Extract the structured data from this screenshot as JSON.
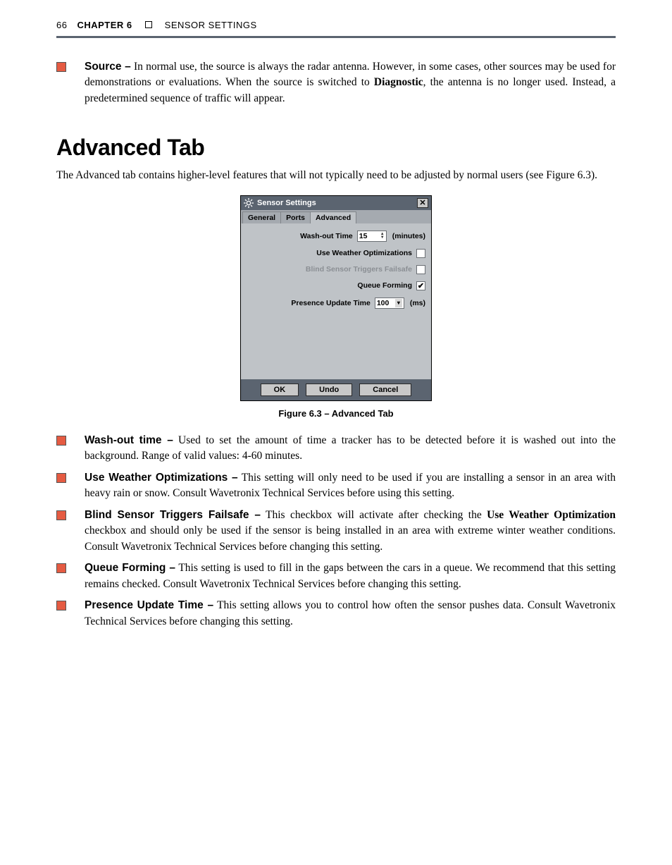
{
  "header": {
    "pageno": "66",
    "chapter_label": "CHAPTER 6",
    "section_name": "SENSOR SETTINGS"
  },
  "bullet_top": {
    "term": "Source –",
    "text": " In normal use, the source is always the radar antenna. However, in some cases, other sources may be used for demonstrations or evaluations. When the source is switched to ",
    "bold_inline": "Diagnostic",
    "text2": ", the antenna is no longer used. Instead, a predetermined sequence of traffic will appear."
  },
  "section_heading": "Advanced Tab",
  "intro_para": "The Advanced tab contains higher-level features that will not typically need to be adjusted by normal users (see Figure 6.3).",
  "dialog": {
    "title": "Sensor Settings",
    "tabs": [
      "General",
      "Ports",
      "Advanced"
    ],
    "active_tab_index": 2,
    "washout_label": "Wash-out Time",
    "washout_value": "15",
    "washout_unit": "(minutes)",
    "weather_label": "Use Weather Optimizations",
    "blind_label": "Blind Sensor Triggers Failsafe",
    "queue_label": "Queue Forming",
    "queue_checked": "✔",
    "presence_label": "Presence Update Time",
    "presence_value": "100",
    "presence_unit": "(ms)",
    "buttons": {
      "ok": "OK",
      "undo": "Undo",
      "cancel": "Cancel"
    }
  },
  "figure_caption": "Figure 6.3 – Advanced Tab",
  "bullets": [
    {
      "term": "Wash-out time –",
      "text": " Used to set the amount of time a tracker has to be detected before it is washed out into the background. Range of valid values: 4-60 minutes."
    },
    {
      "term": "Use Weather Optimizations –",
      "text": " This setting will only need to be used if you are installing a sensor in an area with heavy rain or snow. Consult Wavetronix Technical Services before using this setting."
    },
    {
      "term": "Blind Sensor Triggers Failsafe –",
      "text": " This checkbox will activate after checking the ",
      "bold_inline": "Use Weather Optimization",
      "text2": " checkbox and should only be used if the sensor is being installed in an area with extreme winter weather conditions. Consult Wavetronix Technical Services before changing this setting."
    },
    {
      "term": "Queue Forming –",
      "text": " This setting is used to fill in the gaps between the cars in a queue. We recommend that this setting remains checked. Consult Wavetronix Technical Services before changing this setting."
    },
    {
      "term": "Presence Update Time –",
      "text": " This setting allows you to control how often the sensor pushes data. Consult Wavetronix Technical Services before changing this setting."
    }
  ]
}
